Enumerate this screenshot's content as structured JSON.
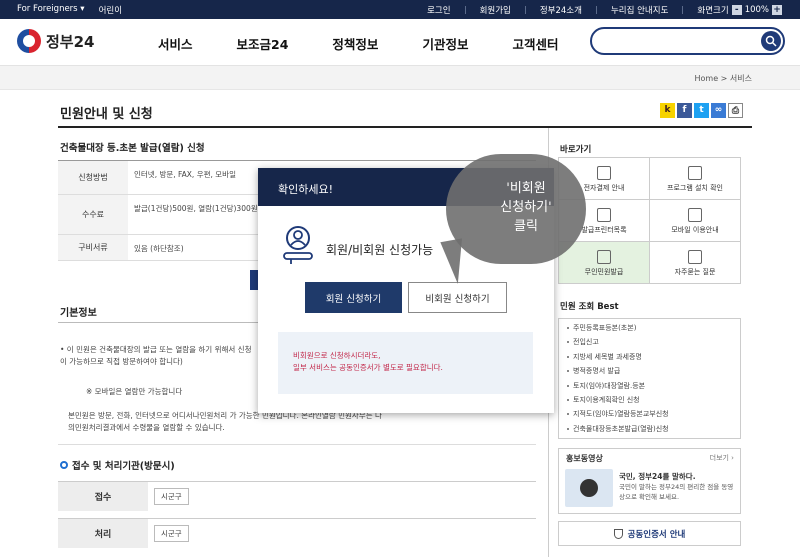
{
  "topbar": {
    "for_foreigners": "For Foreigners ▾",
    "kids": "어린이",
    "login": "로그인",
    "join": "회원가입",
    "intro": "정부24소개",
    "sitemap": "누리집 안내지도",
    "screen_size": "화면크기",
    "zoom_minus": "-",
    "zoom_value": "100%",
    "zoom_plus": "+"
  },
  "header": {
    "logo_text": "정부24",
    "menu": [
      "서비스",
      "보조금24",
      "정책정보",
      "기관정보",
      "고객센터"
    ]
  },
  "breadcrumb": {
    "home": "Home",
    "sep": ">",
    "current": "서비스"
  },
  "page_title": "민원안내 및 신청",
  "service_title": "건축물대장 등.초본 발급(열람) 신청",
  "table": [
    {
      "label": "신청방법",
      "value": "인터넷, 방문, FAX, 우편, 모바일"
    },
    {
      "label": "수수료",
      "value": "발급(1건당)500원, 열람(1건당)300원, 인 (열람)시 무료"
    },
    {
      "label": "구비서류",
      "value": "있음 (하단참조)"
    }
  ],
  "section_basic": "기본정보",
  "basic_text1": "• 이 민원은 건축물대장의 발급 또는 열람을 하기 위해서 신청 이 가능하므로 직접 방문하여야 합니다)",
  "basic_note": "※ 모바일은 열람만 가능합니다",
  "basic_text2": "본민원은 방문, 전화, 인터넷으로 어디서나민원처리 가 가능한 민원입니다. 온라인열람 민원사무는 나의민원처리결과에서 수령물을 열람할 수 있습니다.",
  "section_office": "접수 및 처리기관(방문시)",
  "process": [
    {
      "label": "접수",
      "value": "시군구"
    },
    {
      "label": "처리",
      "value": "시군구"
    }
  ],
  "shortcuts_title": "바로가기",
  "shortcuts": [
    "전자결제 안내",
    "프로그램 설치 확인",
    "발급프린터목록",
    "모바일 이용안내",
    "무인민원발급",
    "자주묻는 질문"
  ],
  "best_title": "민원 조회 Best",
  "best_items": [
    "주민등록표등본(초본)",
    "전입신고",
    "지방세 세목별 과세증명",
    "병적증명서 발급",
    "토지(임야)대장열람.등본",
    "토지이용계획확인 신청",
    "지적도(임야도)열람등본교부신청",
    "건축물대장등초본발급(열람)신청"
  ],
  "promo": {
    "title": "홍보동영상",
    "more": "더보기 ›",
    "headline": "국민, 정부24를 말하다.",
    "desc": "국민이 말하는 정부24의 편리한 점을 동영상으로 확인해 보세요."
  },
  "cert_label": "공동인증서 안내",
  "modal": {
    "title": "확인하세요!",
    "question": "회원/비회원 신청가능",
    "member_btn": "회원 신청하기",
    "nonmember_btn": "비회원 신청하기",
    "note_line1": "비회원으로 신청하시더라도,",
    "note_line2": "일부 서비스는 공동인증서가 별도로 필요합니다."
  },
  "annotation": {
    "line1": "'비회원",
    "line2": "신청하기'",
    "line3": "클릭"
  }
}
